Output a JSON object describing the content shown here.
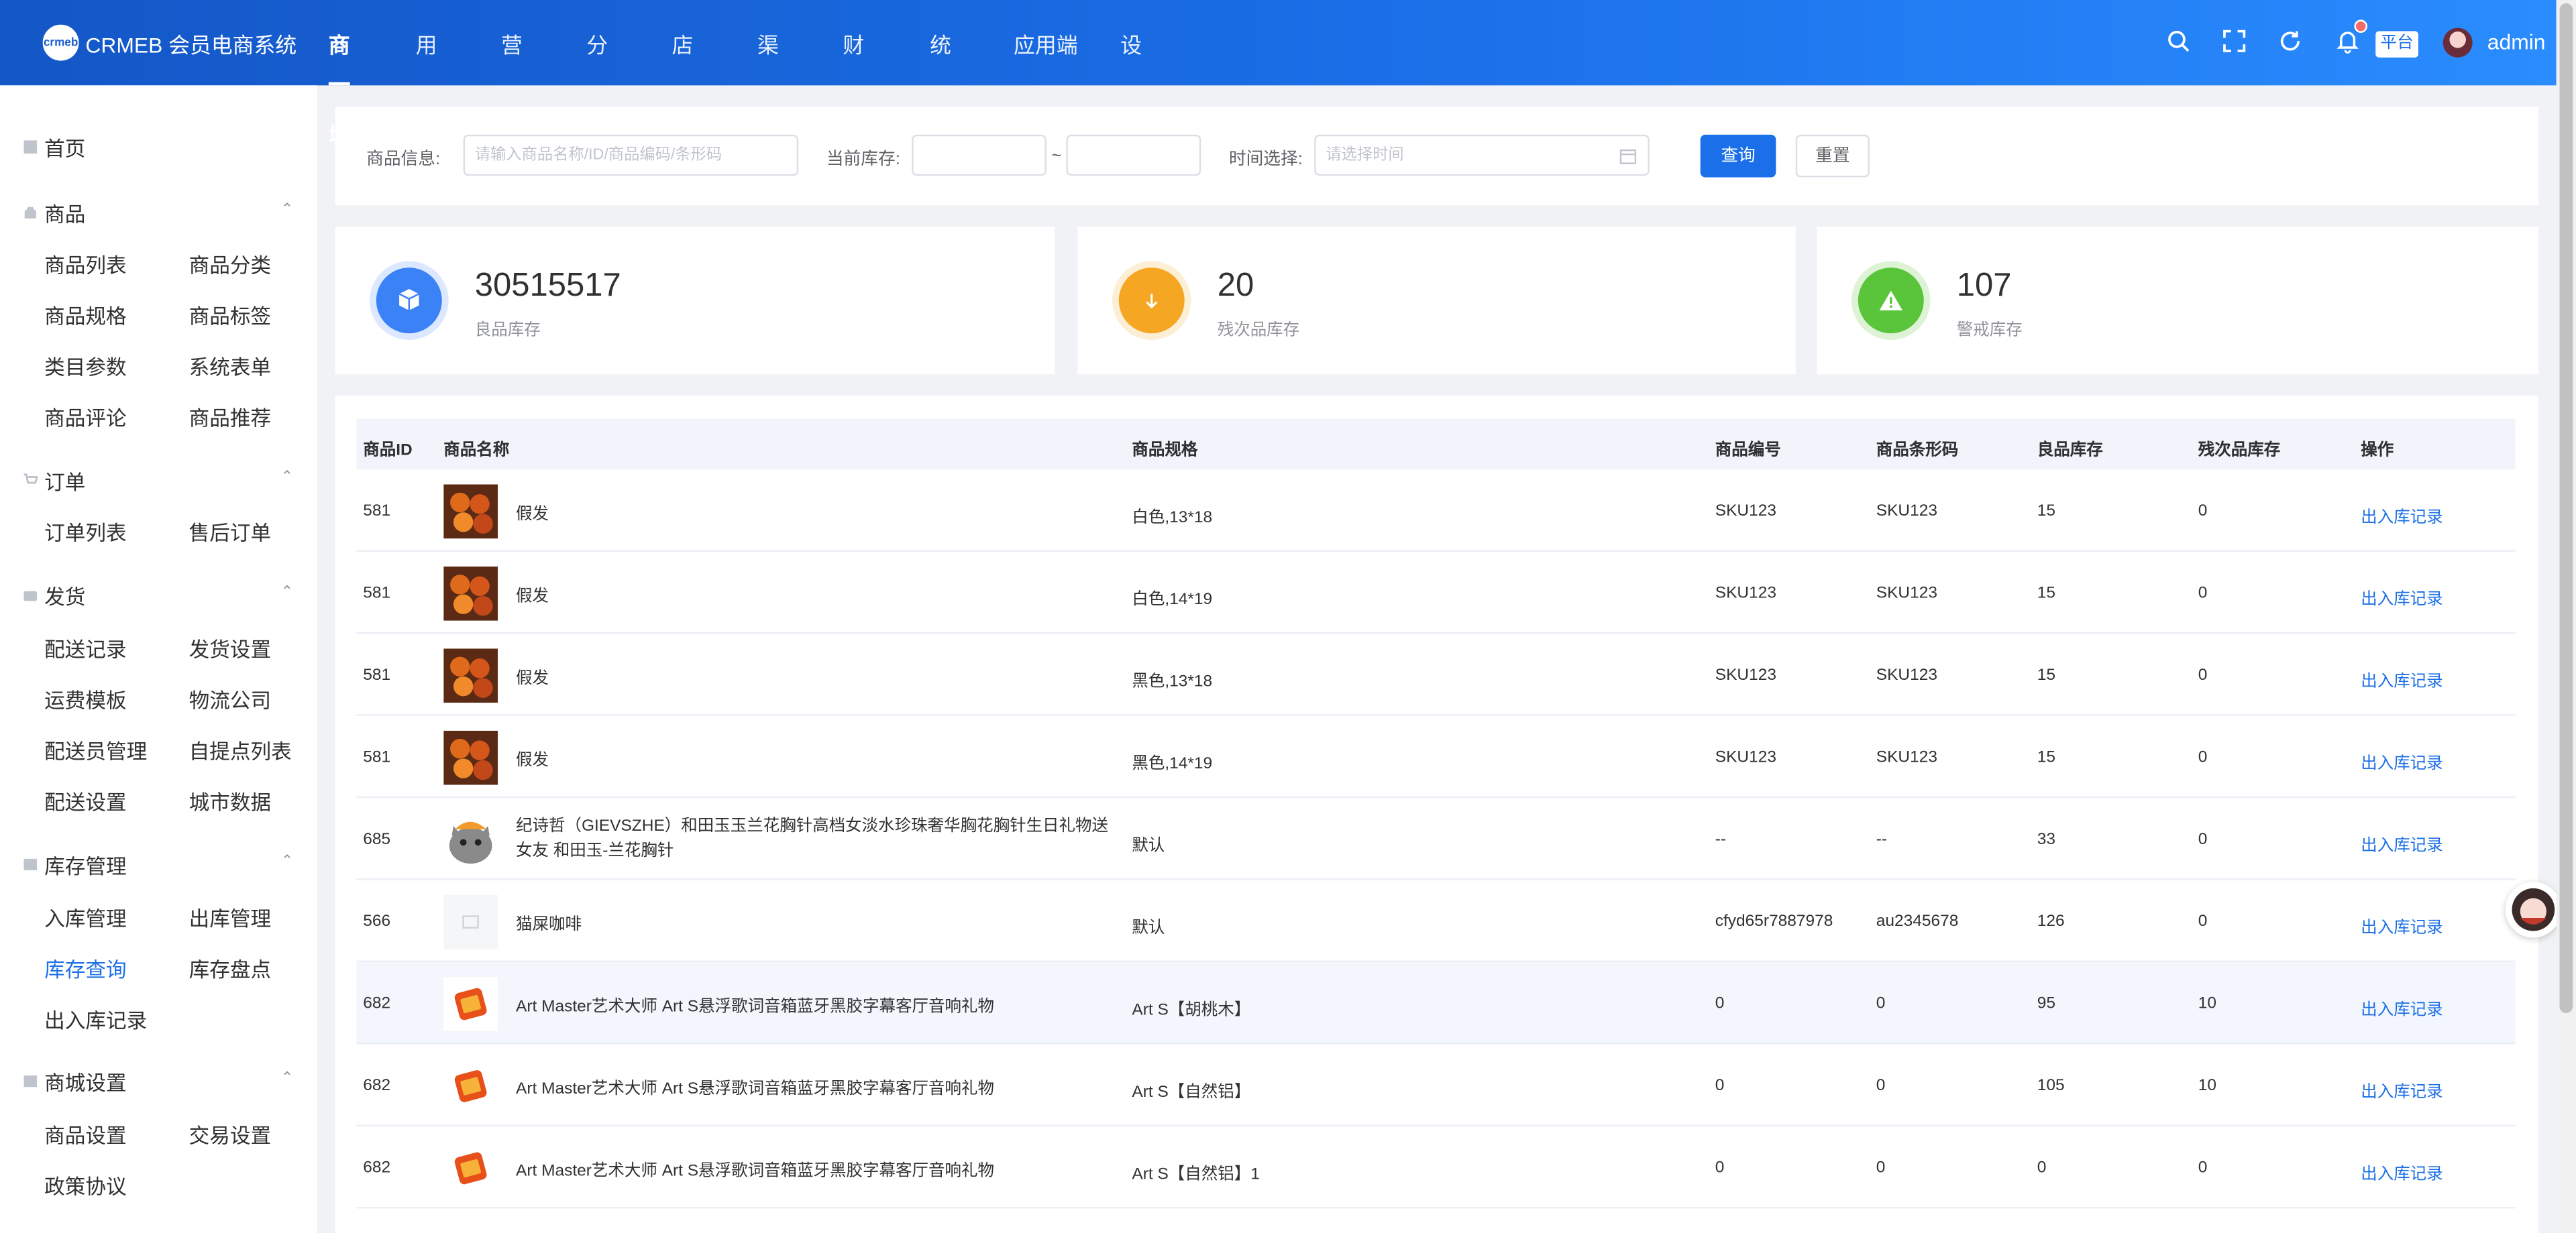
{
  "brand": {
    "logo_text": "crmeb",
    "name": "CRMEB 会员电商系统"
  },
  "nav": [
    "商城",
    "用户",
    "营销",
    "分销",
    "店铺",
    "渠道",
    "财务",
    "统计",
    "应用端",
    "设置"
  ],
  "header": {
    "platform_tag": "平台",
    "user": "admin"
  },
  "sidebar": {
    "home": "首页",
    "groups": [
      {
        "title": "商品",
        "items": [
          "商品列表",
          "商品分类",
          "商品规格",
          "商品标签",
          "类目参数",
          "系统表单",
          "商品评论",
          "商品推荐"
        ]
      },
      {
        "title": "订单",
        "items": [
          "订单列表",
          "售后订单"
        ]
      },
      {
        "title": "发货",
        "items": [
          "配送记录",
          "发货设置",
          "运费模板",
          "物流公司",
          "配送员管理",
          "自提点列表",
          "配送设置",
          "城市数据"
        ]
      },
      {
        "title": "库存管理",
        "items": [
          "入库管理",
          "出库管理",
          "库存查询",
          "库存盘点",
          "出入库记录"
        ]
      },
      {
        "title": "商城设置",
        "items": [
          "商品设置",
          "交易设置",
          "政策协议"
        ]
      }
    ]
  },
  "filters": {
    "product_label": "商品信息:",
    "product_placeholder": "请输入商品名称/ID/商品编码/条形码",
    "stock_label": "当前库存:",
    "range_sep": "~",
    "time_label": "时间选择:",
    "time_placeholder": "请选择时间",
    "query_btn": "查询",
    "reset_btn": "重置"
  },
  "stats": [
    {
      "value": "30515517",
      "label": "良品库存",
      "color": "#3b82f6"
    },
    {
      "value": "20",
      "label": "残次品库存",
      "color": "#f5a623"
    },
    {
      "value": "107",
      "label": "警戒库存",
      "color": "#5ac53a"
    }
  ],
  "table": {
    "headers": [
      "商品ID",
      "商品名称",
      "商品规格",
      "商品编号",
      "商品条形码",
      "良品库存",
      "残次品库存",
      "操作"
    ],
    "rows": [
      {
        "id": "581",
        "name": "假发",
        "spec": "白色,13*18",
        "code": "SKU123",
        "barcode": "SKU123",
        "good": "15",
        "defect": "0",
        "action": "出入库记录",
        "thumb": "food"
      },
      {
        "id": "581",
        "name": "假发",
        "spec": "白色,14*19",
        "code": "SKU123",
        "barcode": "SKU123",
        "good": "15",
        "defect": "0",
        "action": "出入库记录",
        "thumb": "food"
      },
      {
        "id": "581",
        "name": "假发",
        "spec": "黑色,13*18",
        "code": "SKU123",
        "barcode": "SKU123",
        "good": "15",
        "defect": "0",
        "action": "出入库记录",
        "thumb": "food"
      },
      {
        "id": "581",
        "name": "假发",
        "spec": "黑色,14*19",
        "code": "SKU123",
        "barcode": "SKU123",
        "good": "15",
        "defect": "0",
        "action": "出入库记录",
        "thumb": "food"
      },
      {
        "id": "685",
        "name": "纪诗哲（GIEVSZHE）和田玉玉兰花胸针高档女淡水珍珠奢华胸花胸针生日礼物送女友 和田玉-兰花胸针",
        "spec": "默认",
        "code": "--",
        "barcode": "--",
        "good": "33",
        "defect": "0",
        "action": "出入库记录",
        "thumb": "cat"
      },
      {
        "id": "566",
        "name": "猫屎咖啡",
        "spec": "默认",
        "code": "cfyd65r7887978",
        "barcode": "au2345678",
        "good": "126",
        "defect": "0",
        "action": "出入库记录",
        "thumb": "blank"
      },
      {
        "id": "682",
        "name": "Art Master艺术大师 Art S悬浮歌词音箱蓝牙黑胶字幕客厅音响礼物",
        "spec": "Art S【胡桃木】",
        "code": "0",
        "barcode": "0",
        "good": "95",
        "defect": "10",
        "action": "出入库记录",
        "thumb": "box"
      },
      {
        "id": "682",
        "name": "Art Master艺术大师 Art S悬浮歌词音箱蓝牙黑胶字幕客厅音响礼物",
        "spec": "Art S【自然铝】",
        "code": "0",
        "barcode": "0",
        "good": "105",
        "defect": "10",
        "action": "出入库记录",
        "thumb": "box"
      },
      {
        "id": "682",
        "name": "Art Master艺术大师 Art S悬浮歌词音箱蓝牙黑胶字幕客厅音响礼物",
        "spec": "Art S【自然铝】1",
        "code": "0",
        "barcode": "0",
        "good": "0",
        "defect": "0",
        "action": "出入库记录",
        "thumb": "box"
      }
    ]
  }
}
